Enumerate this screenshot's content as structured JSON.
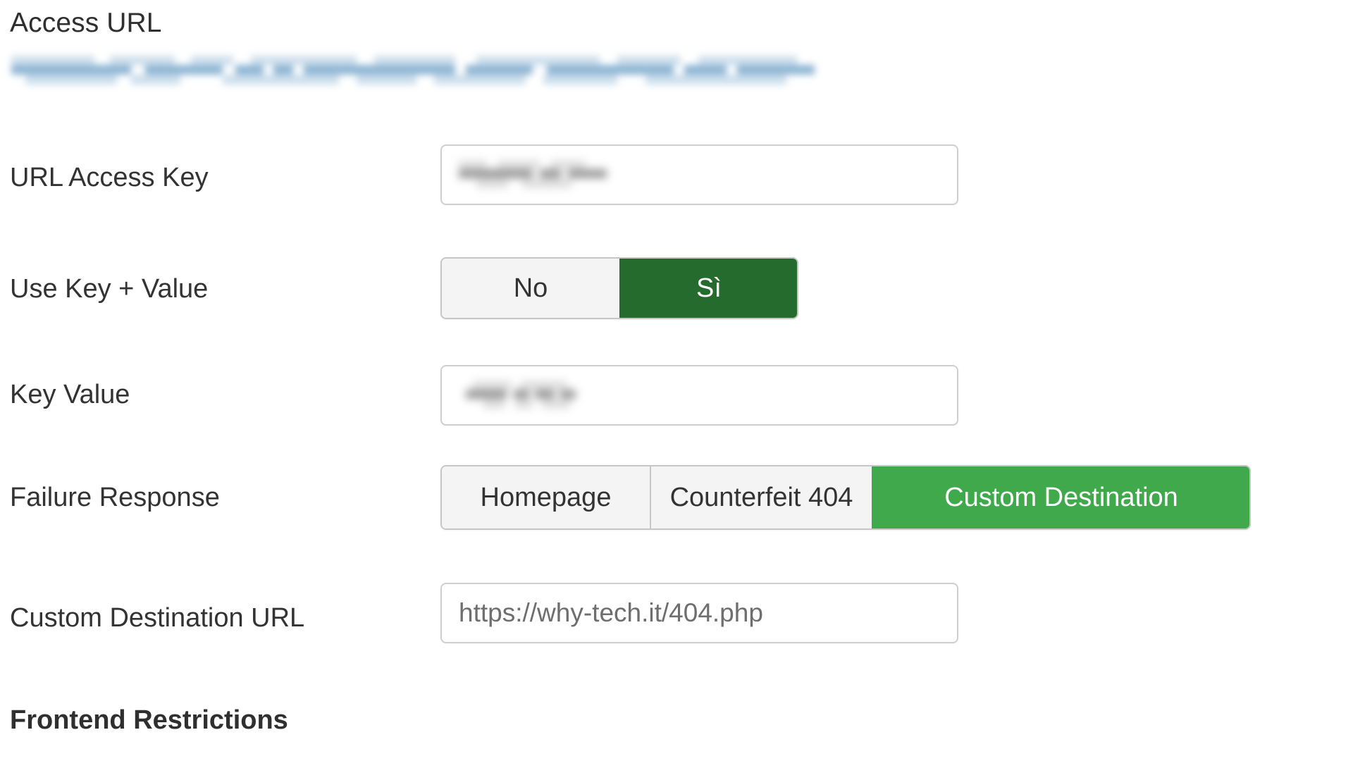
{
  "access_url": {
    "title": "Access URL",
    "value_redacted": true,
    "redaction_color": "#8fb6d4"
  },
  "rows": [
    {
      "label": "URL Access Key",
      "control": "text-input",
      "value": "",
      "value_redacted": true
    },
    {
      "label": "Use Key + Value",
      "control": "segmented",
      "options": [
        "No",
        "Sì"
      ],
      "selected": "Sì"
    },
    {
      "label": "Key Value",
      "control": "text-input",
      "value": "",
      "value_redacted": true
    },
    {
      "label": "Failure Response",
      "control": "segmented",
      "options": [
        "Homepage",
        "Counterfeit 404",
        "Custom Destination"
      ],
      "selected": "Custom Destination"
    },
    {
      "label": "Custom Destination URL",
      "control": "text-input",
      "value": "https://why-tech.it/404.php",
      "value_redacted": false
    }
  ],
  "section_heading": "Frontend Restrictions",
  "colors": {
    "active_yes_green": "#256b2e",
    "active_custom_green": "#3fa94c",
    "segment_inactive": "#f4f4f4",
    "border": "#c6c6c6",
    "label_text": "#333333",
    "input_text": "#6e6e6e",
    "redaction_blue": "#8fb6d4",
    "redaction_gray": "#9b9b9b"
  }
}
